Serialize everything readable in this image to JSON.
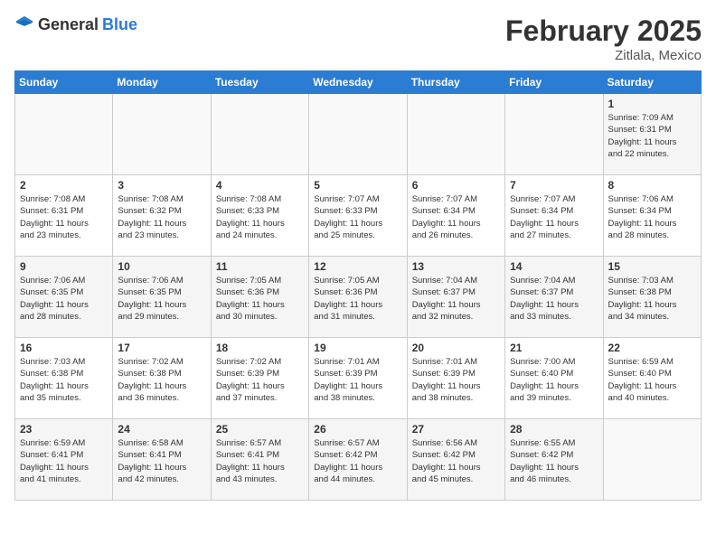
{
  "header": {
    "logo_general": "General",
    "logo_blue": "Blue",
    "title": "February 2025",
    "subtitle": "Zitlala, Mexico"
  },
  "days_of_week": [
    "Sunday",
    "Monday",
    "Tuesday",
    "Wednesday",
    "Thursday",
    "Friday",
    "Saturday"
  ],
  "weeks": [
    [
      {
        "num": "",
        "info": ""
      },
      {
        "num": "",
        "info": ""
      },
      {
        "num": "",
        "info": ""
      },
      {
        "num": "",
        "info": ""
      },
      {
        "num": "",
        "info": ""
      },
      {
        "num": "",
        "info": ""
      },
      {
        "num": "1",
        "info": "Sunrise: 7:09 AM\nSunset: 6:31 PM\nDaylight: 11 hours\nand 22 minutes."
      }
    ],
    [
      {
        "num": "2",
        "info": "Sunrise: 7:08 AM\nSunset: 6:31 PM\nDaylight: 11 hours\nand 23 minutes."
      },
      {
        "num": "3",
        "info": "Sunrise: 7:08 AM\nSunset: 6:32 PM\nDaylight: 11 hours\nand 23 minutes."
      },
      {
        "num": "4",
        "info": "Sunrise: 7:08 AM\nSunset: 6:33 PM\nDaylight: 11 hours\nand 24 minutes."
      },
      {
        "num": "5",
        "info": "Sunrise: 7:07 AM\nSunset: 6:33 PM\nDaylight: 11 hours\nand 25 minutes."
      },
      {
        "num": "6",
        "info": "Sunrise: 7:07 AM\nSunset: 6:34 PM\nDaylight: 11 hours\nand 26 minutes."
      },
      {
        "num": "7",
        "info": "Sunrise: 7:07 AM\nSunset: 6:34 PM\nDaylight: 11 hours\nand 27 minutes."
      },
      {
        "num": "8",
        "info": "Sunrise: 7:06 AM\nSunset: 6:34 PM\nDaylight: 11 hours\nand 28 minutes."
      }
    ],
    [
      {
        "num": "9",
        "info": "Sunrise: 7:06 AM\nSunset: 6:35 PM\nDaylight: 11 hours\nand 28 minutes."
      },
      {
        "num": "10",
        "info": "Sunrise: 7:06 AM\nSunset: 6:35 PM\nDaylight: 11 hours\nand 29 minutes."
      },
      {
        "num": "11",
        "info": "Sunrise: 7:05 AM\nSunset: 6:36 PM\nDaylight: 11 hours\nand 30 minutes."
      },
      {
        "num": "12",
        "info": "Sunrise: 7:05 AM\nSunset: 6:36 PM\nDaylight: 11 hours\nand 31 minutes."
      },
      {
        "num": "13",
        "info": "Sunrise: 7:04 AM\nSunset: 6:37 PM\nDaylight: 11 hours\nand 32 minutes."
      },
      {
        "num": "14",
        "info": "Sunrise: 7:04 AM\nSunset: 6:37 PM\nDaylight: 11 hours\nand 33 minutes."
      },
      {
        "num": "15",
        "info": "Sunrise: 7:03 AM\nSunset: 6:38 PM\nDaylight: 11 hours\nand 34 minutes."
      }
    ],
    [
      {
        "num": "16",
        "info": "Sunrise: 7:03 AM\nSunset: 6:38 PM\nDaylight: 11 hours\nand 35 minutes."
      },
      {
        "num": "17",
        "info": "Sunrise: 7:02 AM\nSunset: 6:38 PM\nDaylight: 11 hours\nand 36 minutes."
      },
      {
        "num": "18",
        "info": "Sunrise: 7:02 AM\nSunset: 6:39 PM\nDaylight: 11 hours\nand 37 minutes."
      },
      {
        "num": "19",
        "info": "Sunrise: 7:01 AM\nSunset: 6:39 PM\nDaylight: 11 hours\nand 38 minutes."
      },
      {
        "num": "20",
        "info": "Sunrise: 7:01 AM\nSunset: 6:39 PM\nDaylight: 11 hours\nand 38 minutes."
      },
      {
        "num": "21",
        "info": "Sunrise: 7:00 AM\nSunset: 6:40 PM\nDaylight: 11 hours\nand 39 minutes."
      },
      {
        "num": "22",
        "info": "Sunrise: 6:59 AM\nSunset: 6:40 PM\nDaylight: 11 hours\nand 40 minutes."
      }
    ],
    [
      {
        "num": "23",
        "info": "Sunrise: 6:59 AM\nSunset: 6:41 PM\nDaylight: 11 hours\nand 41 minutes."
      },
      {
        "num": "24",
        "info": "Sunrise: 6:58 AM\nSunset: 6:41 PM\nDaylight: 11 hours\nand 42 minutes."
      },
      {
        "num": "25",
        "info": "Sunrise: 6:57 AM\nSunset: 6:41 PM\nDaylight: 11 hours\nand 43 minutes."
      },
      {
        "num": "26",
        "info": "Sunrise: 6:57 AM\nSunset: 6:42 PM\nDaylight: 11 hours\nand 44 minutes."
      },
      {
        "num": "27",
        "info": "Sunrise: 6:56 AM\nSunset: 6:42 PM\nDaylight: 11 hours\nand 45 minutes."
      },
      {
        "num": "28",
        "info": "Sunrise: 6:55 AM\nSunset: 6:42 PM\nDaylight: 11 hours\nand 46 minutes."
      },
      {
        "num": "",
        "info": ""
      }
    ]
  ]
}
